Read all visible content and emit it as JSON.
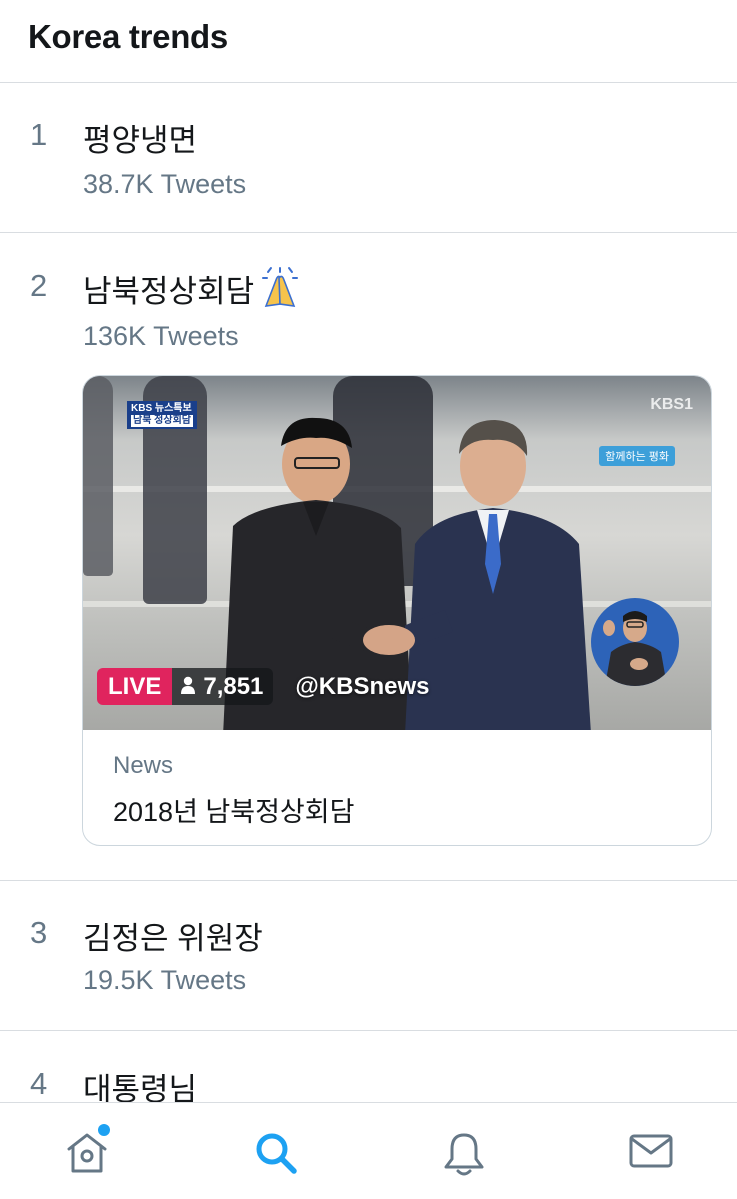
{
  "header": {
    "title": "Korea trends"
  },
  "trends": [
    {
      "rank": "1",
      "name": "평양냉면",
      "count": "38.7K Tweets"
    },
    {
      "rank": "2",
      "name": "남북정상회담",
      "count": "136K Tweets"
    },
    {
      "rank": "3",
      "name": "김정은 위원장",
      "count": "19.5K Tweets"
    },
    {
      "rank": "4",
      "name": "대통령님"
    }
  ],
  "card": {
    "live_label": "LIVE",
    "viewer_count": "7,851",
    "handle": "@KBSnews",
    "category": "News",
    "title": "2018년 남북정상회담",
    "overlay_badge": "KBS 뉴스특보",
    "overlay_badge_sub": "남북 정상회담",
    "channel": "KBS1",
    "peace_logo": "함께하는 평화"
  },
  "tabbar": {
    "tabs": [
      {
        "name": "home",
        "icon": "home-icon",
        "active": false,
        "has_notification_dot": true
      },
      {
        "name": "search",
        "icon": "search-icon",
        "active": true
      },
      {
        "name": "notifications",
        "icon": "bell-icon",
        "active": false
      },
      {
        "name": "messages",
        "icon": "mail-icon",
        "active": false
      }
    ]
  },
  "colors": {
    "accent": "#1da1f2",
    "live": "#e0245e",
    "secondary_text": "#657786",
    "divider": "#d9dde1"
  }
}
